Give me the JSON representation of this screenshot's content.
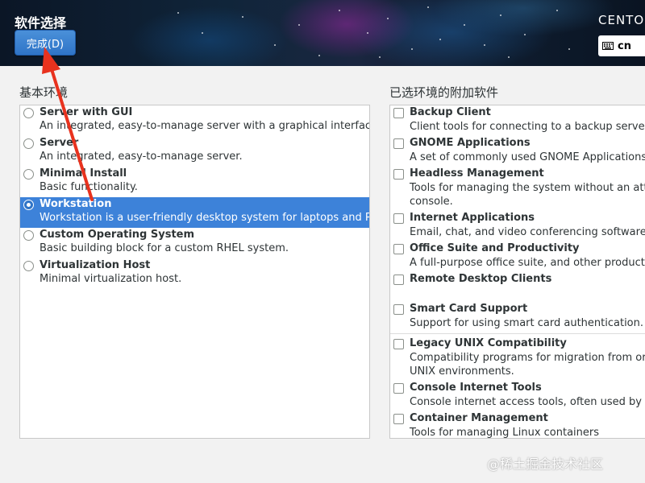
{
  "header": {
    "title": "软件选择",
    "done_button": "完成(D)",
    "product": "CENTOS",
    "keyboard_layout": "cn"
  },
  "environments": {
    "label": "基本环境",
    "items": [
      {
        "name": "Server with GUI",
        "desc": "An integrated, easy-to-manage server with a graphical interface.",
        "selected": false
      },
      {
        "name": "Server",
        "desc": "An integrated, easy-to-manage server.",
        "selected": false
      },
      {
        "name": "Minimal Install",
        "desc": "Basic functionality.",
        "selected": false
      },
      {
        "name": "Workstation",
        "desc": "Workstation is a user-friendly desktop system for laptops and PCs.",
        "selected": true
      },
      {
        "name": "Custom Operating System",
        "desc": "Basic building block for a custom RHEL system.",
        "selected": false
      },
      {
        "name": "Virtualization Host",
        "desc": "Minimal virtualization host.",
        "selected": false
      }
    ]
  },
  "addons": {
    "label": "已选环境的附加软件",
    "items": [
      {
        "name": "Backup Client",
        "desc": [
          "Client tools for connecting to a backup server and"
        ],
        "checked": false
      },
      {
        "name": "GNOME Applications",
        "desc": [
          "A set of commonly used GNOME Applications."
        ],
        "checked": false
      },
      {
        "name": "Headless Management",
        "desc": [
          "Tools for managing the system without an attach",
          "console."
        ],
        "checked": false
      },
      {
        "name": "Internet Applications",
        "desc": [
          "Email, chat, and video conferencing software."
        ],
        "checked": false
      },
      {
        "name": "Office Suite and Productivity",
        "desc": [
          "A full-purpose office suite, and other productivity"
        ],
        "checked": false
      },
      {
        "name": "Remote Desktop Clients",
        "desc": [],
        "checked": false
      },
      {
        "name": "Smart Card Support",
        "desc": [
          "Support for using smart card authentication."
        ],
        "checked": false
      },
      {
        "name": "Legacy UNIX Compatibility",
        "desc": [
          "Compatibility programs for migration from or wo",
          "UNIX environments."
        ],
        "checked": false
      },
      {
        "name": "Console Internet Tools",
        "desc": [
          "Console internet access tools, often used by adm"
        ],
        "checked": false
      },
      {
        "name": "Container Management",
        "desc": [
          "Tools for managing Linux containers"
        ],
        "checked": false
      }
    ]
  },
  "watermark": "@稀土掘金技术社区",
  "colors": {
    "selection": "#3d82d9",
    "button": "#2f74c7",
    "arrow": "#e8321e"
  }
}
